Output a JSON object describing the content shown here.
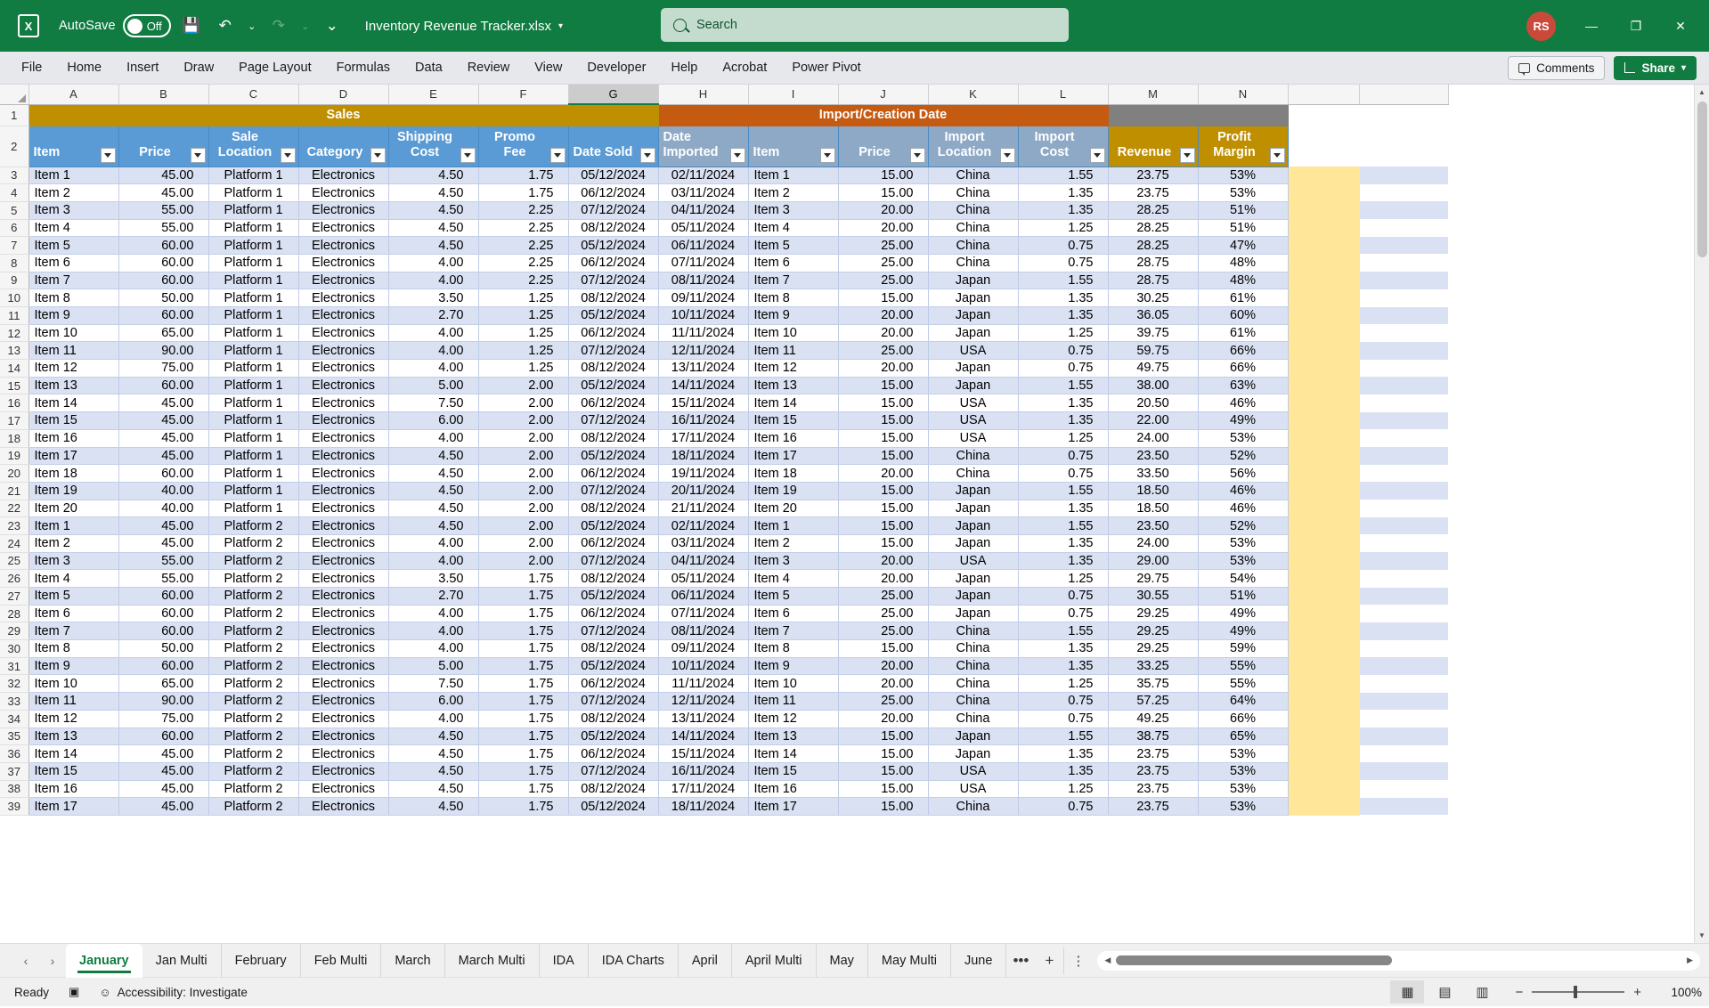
{
  "titlebar": {
    "app_icon": "excel-icon",
    "autosave_label": "AutoSave",
    "autosave_state": "Off",
    "save_icon": "save-icon",
    "undo_icon": "undo-icon",
    "redo_icon": "redo-icon",
    "customize_icon": "customize-quick-access-icon",
    "document_title": "Inventory Revenue Tracker.xlsx",
    "user_initials": "RS",
    "minimize": "—",
    "maximize": "❐",
    "close": "✕"
  },
  "search": {
    "placeholder": "Search",
    "icon": "search-icon"
  },
  "ribbon": {
    "tabs": [
      "File",
      "Home",
      "Insert",
      "Draw",
      "Page Layout",
      "Formulas",
      "Data",
      "Review",
      "View",
      "Developer",
      "Help",
      "Acrobat",
      "Power Pivot"
    ],
    "comments_label": "Comments",
    "share_label": "Share"
  },
  "grid": {
    "columns": [
      "A",
      "B",
      "C",
      "D",
      "E",
      "F",
      "G",
      "H",
      "I",
      "J",
      "K",
      "L",
      "M",
      "N"
    ],
    "selected_column": "G",
    "banners": [
      {
        "label": "Sales",
        "color": "#bf8f00",
        "span": 7
      },
      {
        "label": "Import/Creation Date",
        "color": "#c55a11",
        "span": 5
      },
      {
        "label": "",
        "color": "#808080",
        "span": 2
      }
    ],
    "headers": [
      {
        "label": "Item",
        "align": "left",
        "group": "sales"
      },
      {
        "label": "Price",
        "align": "center",
        "group": "sales"
      },
      {
        "label": "Sale Location",
        "align": "center",
        "group": "sales"
      },
      {
        "label": "Category",
        "align": "center",
        "group": "sales"
      },
      {
        "label": "Shipping Cost",
        "align": "center",
        "group": "sales"
      },
      {
        "label": "Promo Fee",
        "align": "center",
        "group": "sales"
      },
      {
        "label": "Date Sold",
        "align": "left",
        "group": "sales"
      },
      {
        "label": "Date Imported",
        "align": "left",
        "group": "import"
      },
      {
        "label": "Item",
        "align": "left",
        "group": "import"
      },
      {
        "label": "Price",
        "align": "center",
        "group": "import"
      },
      {
        "label": "Import Location",
        "align": "center",
        "group": "import"
      },
      {
        "label": "Import Cost",
        "align": "center",
        "group": "import"
      },
      {
        "label": "Revenue",
        "align": "center",
        "group": "revenue"
      },
      {
        "label": "Profit Margin",
        "align": "center",
        "group": "revenue"
      }
    ],
    "row_numbers": [
      3,
      4,
      5,
      6,
      7,
      8,
      9,
      10,
      11,
      12,
      13,
      14,
      15,
      16,
      17,
      18,
      19,
      20,
      21,
      22,
      23,
      24,
      25,
      26,
      27,
      28,
      29,
      30,
      31,
      32,
      33,
      34,
      35,
      36,
      37,
      38,
      39
    ],
    "rows": [
      [
        "Item 1",
        "45.00",
        "Platform 1",
        "Electronics",
        "4.50",
        "1.75",
        "05/12/2024",
        "02/11/2024",
        "Item 1",
        "15.00",
        "China",
        "1.55",
        "23.75",
        "53%"
      ],
      [
        "Item 2",
        "45.00",
        "Platform 1",
        "Electronics",
        "4.50",
        "1.75",
        "06/12/2024",
        "03/11/2024",
        "Item 2",
        "15.00",
        "China",
        "1.35",
        "23.75",
        "53%"
      ],
      [
        "Item 3",
        "55.00",
        "Platform 1",
        "Electronics",
        "4.50",
        "2.25",
        "07/12/2024",
        "04/11/2024",
        "Item 3",
        "20.00",
        "China",
        "1.35",
        "28.25",
        "51%"
      ],
      [
        "Item 4",
        "55.00",
        "Platform 1",
        "Electronics",
        "4.50",
        "2.25",
        "08/12/2024",
        "05/11/2024",
        "Item 4",
        "20.00",
        "China",
        "1.25",
        "28.25",
        "51%"
      ],
      [
        "Item 5",
        "60.00",
        "Platform 1",
        "Electronics",
        "4.50",
        "2.25",
        "05/12/2024",
        "06/11/2024",
        "Item 5",
        "25.00",
        "China",
        "0.75",
        "28.25",
        "47%"
      ],
      [
        "Item 6",
        "60.00",
        "Platform 1",
        "Electronics",
        "4.00",
        "2.25",
        "06/12/2024",
        "07/11/2024",
        "Item 6",
        "25.00",
        "China",
        "0.75",
        "28.75",
        "48%"
      ],
      [
        "Item 7",
        "60.00",
        "Platform 1",
        "Electronics",
        "4.00",
        "2.25",
        "07/12/2024",
        "08/11/2024",
        "Item 7",
        "25.00",
        "Japan",
        "1.55",
        "28.75",
        "48%"
      ],
      [
        "Item 8",
        "50.00",
        "Platform 1",
        "Electronics",
        "3.50",
        "1.25",
        "08/12/2024",
        "09/11/2024",
        "Item 8",
        "15.00",
        "Japan",
        "1.35",
        "30.25",
        "61%"
      ],
      [
        "Item 9",
        "60.00",
        "Platform 1",
        "Electronics",
        "2.70",
        "1.25",
        "05/12/2024",
        "10/11/2024",
        "Item 9",
        "20.00",
        "Japan",
        "1.35",
        "36.05",
        "60%"
      ],
      [
        "Item 10",
        "65.00",
        "Platform 1",
        "Electronics",
        "4.00",
        "1.25",
        "06/12/2024",
        "11/11/2024",
        "Item 10",
        "20.00",
        "Japan",
        "1.25",
        "39.75",
        "61%"
      ],
      [
        "Item 11",
        "90.00",
        "Platform 1",
        "Electronics",
        "4.00",
        "1.25",
        "07/12/2024",
        "12/11/2024",
        "Item 11",
        "25.00",
        "USA",
        "0.75",
        "59.75",
        "66%"
      ],
      [
        "Item 12",
        "75.00",
        "Platform 1",
        "Electronics",
        "4.00",
        "1.25",
        "08/12/2024",
        "13/11/2024",
        "Item 12",
        "20.00",
        "Japan",
        "0.75",
        "49.75",
        "66%"
      ],
      [
        "Item 13",
        "60.00",
        "Platform 1",
        "Electronics",
        "5.00",
        "2.00",
        "05/12/2024",
        "14/11/2024",
        "Item 13",
        "15.00",
        "Japan",
        "1.55",
        "38.00",
        "63%"
      ],
      [
        "Item 14",
        "45.00",
        "Platform 1",
        "Electronics",
        "7.50",
        "2.00",
        "06/12/2024",
        "15/11/2024",
        "Item 14",
        "15.00",
        "USA",
        "1.35",
        "20.50",
        "46%"
      ],
      [
        "Item 15",
        "45.00",
        "Platform 1",
        "Electronics",
        "6.00",
        "2.00",
        "07/12/2024",
        "16/11/2024",
        "Item 15",
        "15.00",
        "USA",
        "1.35",
        "22.00",
        "49%"
      ],
      [
        "Item 16",
        "45.00",
        "Platform 1",
        "Electronics",
        "4.00",
        "2.00",
        "08/12/2024",
        "17/11/2024",
        "Item 16",
        "15.00",
        "USA",
        "1.25",
        "24.00",
        "53%"
      ],
      [
        "Item 17",
        "45.00",
        "Platform 1",
        "Electronics",
        "4.50",
        "2.00",
        "05/12/2024",
        "18/11/2024",
        "Item 17",
        "15.00",
        "China",
        "0.75",
        "23.50",
        "52%"
      ],
      [
        "Item 18",
        "60.00",
        "Platform 1",
        "Electronics",
        "4.50",
        "2.00",
        "06/12/2024",
        "19/11/2024",
        "Item 18",
        "20.00",
        "China",
        "0.75",
        "33.50",
        "56%"
      ],
      [
        "Item 19",
        "40.00",
        "Platform 1",
        "Electronics",
        "4.50",
        "2.00",
        "07/12/2024",
        "20/11/2024",
        "Item 19",
        "15.00",
        "Japan",
        "1.55",
        "18.50",
        "46%"
      ],
      [
        "Item 20",
        "40.00",
        "Platform 1",
        "Electronics",
        "4.50",
        "2.00",
        "08/12/2024",
        "21/11/2024",
        "Item 20",
        "15.00",
        "Japan",
        "1.35",
        "18.50",
        "46%"
      ],
      [
        "Item 1",
        "45.00",
        "Platform 2",
        "Electronics",
        "4.50",
        "2.00",
        "05/12/2024",
        "02/11/2024",
        "Item 1",
        "15.00",
        "Japan",
        "1.55",
        "23.50",
        "52%"
      ],
      [
        "Item 2",
        "45.00",
        "Platform 2",
        "Electronics",
        "4.00",
        "2.00",
        "06/12/2024",
        "03/11/2024",
        "Item 2",
        "15.00",
        "Japan",
        "1.35",
        "24.00",
        "53%"
      ],
      [
        "Item 3",
        "55.00",
        "Platform 2",
        "Electronics",
        "4.00",
        "2.00",
        "07/12/2024",
        "04/11/2024",
        "Item 3",
        "20.00",
        "USA",
        "1.35",
        "29.00",
        "53%"
      ],
      [
        "Item 4",
        "55.00",
        "Platform 2",
        "Electronics",
        "3.50",
        "1.75",
        "08/12/2024",
        "05/11/2024",
        "Item 4",
        "20.00",
        "Japan",
        "1.25",
        "29.75",
        "54%"
      ],
      [
        "Item 5",
        "60.00",
        "Platform 2",
        "Electronics",
        "2.70",
        "1.75",
        "05/12/2024",
        "06/11/2024",
        "Item 5",
        "25.00",
        "Japan",
        "0.75",
        "30.55",
        "51%"
      ],
      [
        "Item 6",
        "60.00",
        "Platform 2",
        "Electronics",
        "4.00",
        "1.75",
        "06/12/2024",
        "07/11/2024",
        "Item 6",
        "25.00",
        "Japan",
        "0.75",
        "29.25",
        "49%"
      ],
      [
        "Item 7",
        "60.00",
        "Platform 2",
        "Electronics",
        "4.00",
        "1.75",
        "07/12/2024",
        "08/11/2024",
        "Item 7",
        "25.00",
        "China",
        "1.55",
        "29.25",
        "49%"
      ],
      [
        "Item 8",
        "50.00",
        "Platform 2",
        "Electronics",
        "4.00",
        "1.75",
        "08/12/2024",
        "09/11/2024",
        "Item 8",
        "15.00",
        "China",
        "1.35",
        "29.25",
        "59%"
      ],
      [
        "Item 9",
        "60.00",
        "Platform 2",
        "Electronics",
        "5.00",
        "1.75",
        "05/12/2024",
        "10/11/2024",
        "Item 9",
        "20.00",
        "China",
        "1.35",
        "33.25",
        "55%"
      ],
      [
        "Item 10",
        "65.00",
        "Platform 2",
        "Electronics",
        "7.50",
        "1.75",
        "06/12/2024",
        "11/11/2024",
        "Item 10",
        "20.00",
        "China",
        "1.25",
        "35.75",
        "55%"
      ],
      [
        "Item 11",
        "90.00",
        "Platform 2",
        "Electronics",
        "6.00",
        "1.75",
        "07/12/2024",
        "12/11/2024",
        "Item 11",
        "25.00",
        "China",
        "0.75",
        "57.25",
        "64%"
      ],
      [
        "Item 12",
        "75.00",
        "Platform 2",
        "Electronics",
        "4.00",
        "1.75",
        "08/12/2024",
        "13/11/2024",
        "Item 12",
        "20.00",
        "China",
        "0.75",
        "49.25",
        "66%"
      ],
      [
        "Item 13",
        "60.00",
        "Platform 2",
        "Electronics",
        "4.50",
        "1.75",
        "05/12/2024",
        "14/11/2024",
        "Item 13",
        "15.00",
        "Japan",
        "1.55",
        "38.75",
        "65%"
      ],
      [
        "Item 14",
        "45.00",
        "Platform 2",
        "Electronics",
        "4.50",
        "1.75",
        "06/12/2024",
        "15/11/2024",
        "Item 14",
        "15.00",
        "Japan",
        "1.35",
        "23.75",
        "53%"
      ],
      [
        "Item 15",
        "45.00",
        "Platform 2",
        "Electronics",
        "4.50",
        "1.75",
        "07/12/2024",
        "16/11/2024",
        "Item 15",
        "15.00",
        "USA",
        "1.35",
        "23.75",
        "53%"
      ],
      [
        "Item 16",
        "45.00",
        "Platform 2",
        "Electronics",
        "4.50",
        "1.75",
        "08/12/2024",
        "17/11/2024",
        "Item 16",
        "15.00",
        "USA",
        "1.25",
        "23.75",
        "53%"
      ],
      [
        "Item 17",
        "45.00",
        "Platform 2",
        "Electronics",
        "4.50",
        "1.75",
        "05/12/2024",
        "18/11/2024",
        "Item 17",
        "15.00",
        "China",
        "0.75",
        "23.75",
        "53%"
      ]
    ]
  },
  "sheet_tabs": {
    "prev_icon": "chevron-left-icon",
    "next_icon": "chevron-right-icon",
    "tabs": [
      "January",
      "Jan Multi",
      "February",
      "Feb Multi",
      "March",
      "March Multi",
      "IDA",
      "IDA Charts",
      "April",
      "April Multi",
      "May",
      "May Multi",
      "June"
    ],
    "active": "January",
    "more_label": "•••",
    "add_label": "+",
    "kebab_label": "⋮"
  },
  "statusbar": {
    "ready_label": "Ready",
    "record_icon": "macro-record-icon",
    "accessibility_icon": "accessibility-icon",
    "accessibility_label": "Accessibility: Investigate",
    "view_normal_icon": "normal-view-icon",
    "view_pagelayout_icon": "page-layout-view-icon",
    "view_pagebreak_icon": "page-break-preview-icon",
    "zoom_out": "−",
    "zoom_in": "+",
    "zoom_level": "100%"
  },
  "colors": {
    "accent_green": "#107c41",
    "sales_banner": "#bf8f00",
    "import_banner": "#c55a11",
    "grey_banner": "#808080",
    "header_blue": "#5b9bd5",
    "header_mid_blue": "#8ea9c6",
    "row_stripe": "#d9e1f2",
    "tail_yellow": "#ffe699"
  }
}
